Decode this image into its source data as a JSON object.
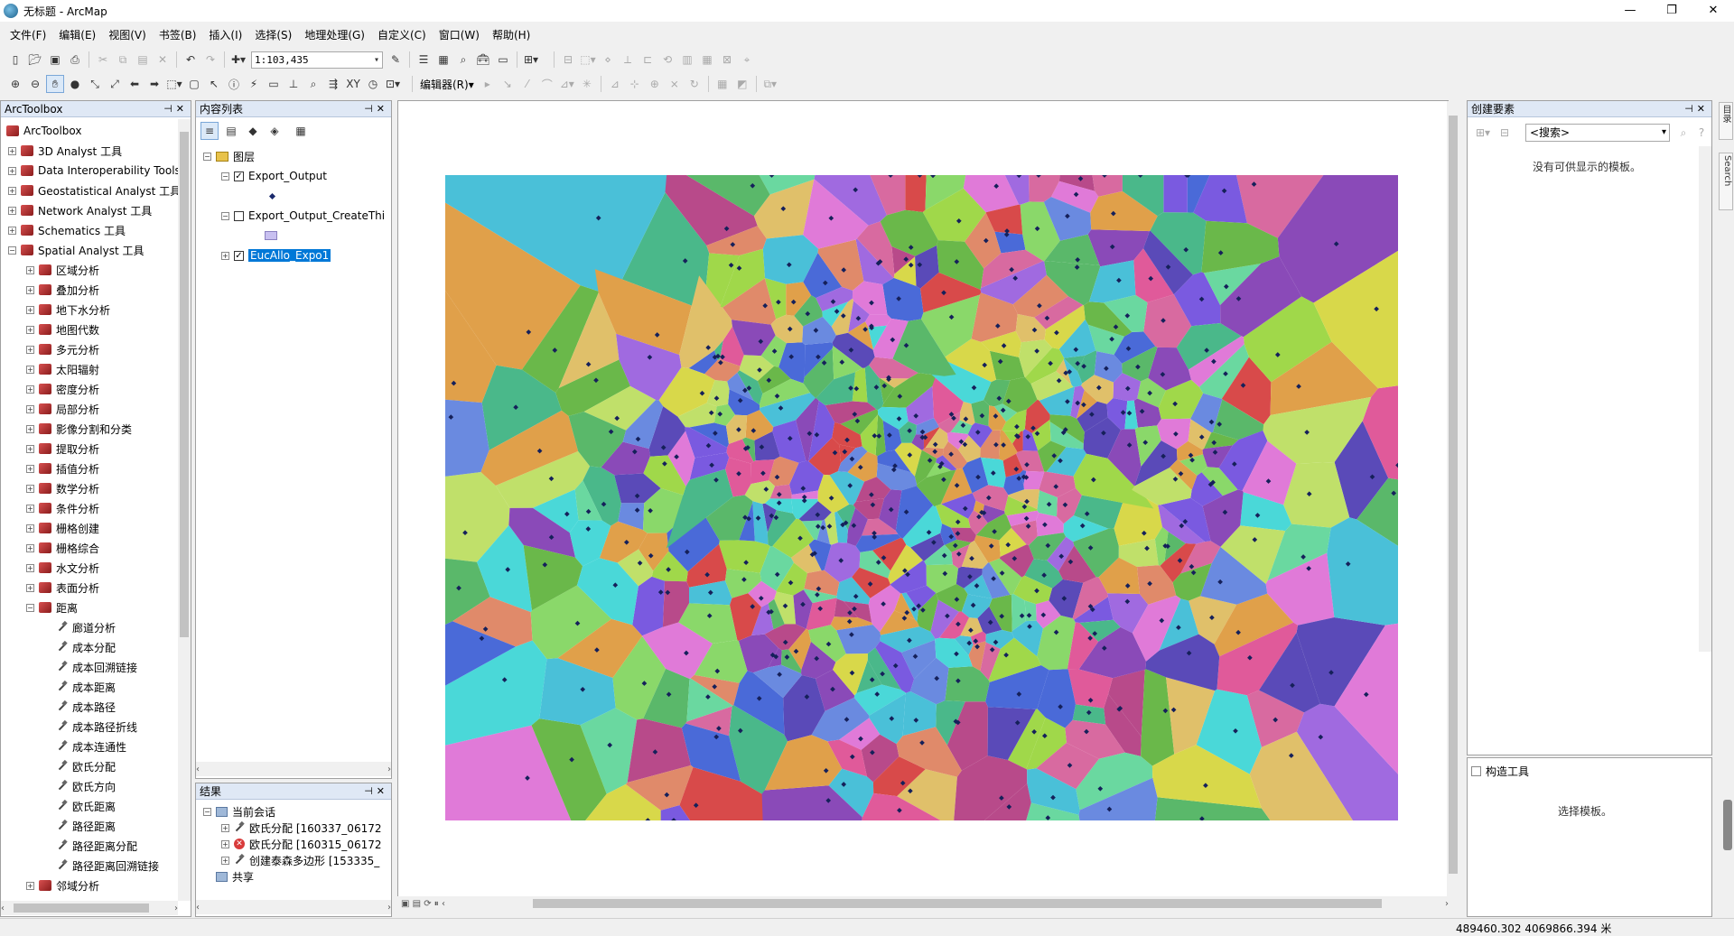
{
  "window": {
    "title": "无标题 - ArcMap",
    "minimize": "—",
    "maximize": "❐",
    "close": "✕"
  },
  "menu": [
    "文件(F)",
    "编辑(E)",
    "视图(V)",
    "书签(B)",
    "插入(I)",
    "选择(S)",
    "地理处理(G)",
    "自定义(C)",
    "窗口(W)",
    "帮助(H)"
  ],
  "toolbar": {
    "scale": "1:103,435",
    "editor_label": "编辑器(R)▾"
  },
  "arctoolbox": {
    "title": "ArcToolbox",
    "root": "ArcToolbox",
    "toolboxes": [
      "3D Analyst 工具",
      "Data Interoperability Tools",
      "Geostatistical Analyst 工具",
      "Network Analyst 工具",
      "Schematics 工具",
      "Spatial Analyst 工具"
    ],
    "spatial_toolsets": [
      "区域分析",
      "叠加分析",
      "地下水分析",
      "地图代数",
      "多元分析",
      "太阳辐射",
      "密度分析",
      "局部分析",
      "影像分割和分类",
      "提取分析",
      "插值分析",
      "数学分析",
      "条件分析",
      "栅格创建",
      "栅格综合",
      "水文分析",
      "表面分析",
      "距离"
    ],
    "distance_tools": [
      "廊道分析",
      "成本分配",
      "成本回溯链接",
      "成本距离",
      "成本路径",
      "成本路径折线",
      "成本连通性",
      "欧氏分配",
      "欧氏方向",
      "欧氏距离",
      "路径距离",
      "路径距离分配",
      "路径距离回溯链接"
    ],
    "last_toolset": "邻域分析"
  },
  "toc": {
    "title": "内容列表",
    "root": "图层",
    "layers": [
      {
        "name": "Export_Output",
        "checked": true
      },
      {
        "name": "Export_Output_CreateThiessenPolygons",
        "checked": false
      },
      {
        "name": "EucAllo_Expo1",
        "checked": true
      }
    ]
  },
  "results": {
    "title": "结果",
    "session": "当前会话",
    "items": [
      "欧氏分配 [160337_06172",
      "欧氏分配 [160315_06172",
      "创建泰森多边形 [153335_"
    ],
    "shared": "共享"
  },
  "create_features": {
    "title": "创建要素",
    "search_placeholder": "<搜索>",
    "empty_msg": "没有可供显示的模板。",
    "construct_title": "构造工具",
    "construct_msg": "选择模板。"
  },
  "side_tabs": [
    "目录",
    "Search"
  ],
  "status": {
    "coords": "489460.302  4069866.394 米"
  },
  "map": {
    "background": "#ffffff",
    "border": "#999999"
  }
}
